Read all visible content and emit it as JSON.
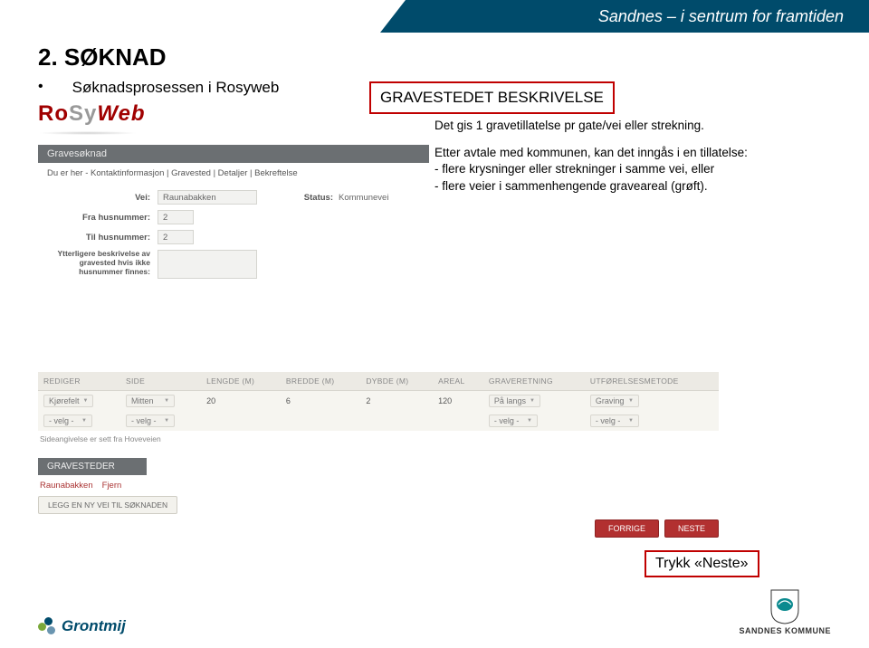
{
  "ribbon": {
    "text": "Sandnes – i sentrum for framtiden"
  },
  "slide": {
    "title": "2. SØKNAD",
    "bullet": "Søknadsprosessen i Rosyweb",
    "box_title": "GRAVESTEDET BESKRIVELSE",
    "side_p1": "Det gis 1 gravetillatelse pr gate/vei eller strekning.",
    "side_p2": "Etter avtale med kommunen, kan det inngås i en tillatelse:",
    "side_li1": "- flere krysninger eller strekninger i samme vei, eller",
    "side_li2": "- flere veier i sammenhengende graveareal (grøft).",
    "neste": "Trykk «Neste»"
  },
  "rosyweb": {
    "p1": "Ro",
    "p2": "Sy",
    "p3": "Web"
  },
  "app": {
    "header": "Gravesøknad",
    "breadcrumb": "Du er her - Kontaktinformasjon | Gravested | Detaljer | Bekreftelse",
    "labels": {
      "vei": "Vei:",
      "fra": "Fra husnummer:",
      "til": "Til husnummer:",
      "ytterligere": "Ytterligere beskrivelse av gravested hvis ikke husnummer finnes:",
      "status": "Status:"
    },
    "values": {
      "vei": "Raunabakken",
      "fra": "2",
      "til": "2",
      "status": "Kommunevei"
    },
    "table": {
      "headers": [
        "REDIGER",
        "SIDE",
        "LENGDE (M)",
        "BREDDE (M)",
        "DYBDE (M)",
        "AREAL",
        "GRAVERETNING",
        "UTFØRELSESMETODE"
      ],
      "row1": [
        "Kjørefelt",
        "Mitten",
        "20",
        "6",
        "2",
        "120",
        "På langs",
        "Graving"
      ],
      "row2_placeholder": "- velg -"
    },
    "sidelabel": "Sideangivelse er sett fra Hoveveien",
    "gs_header": "GRAVESTEDER",
    "gs_item": "Raunabakken",
    "gs_remove": "Fjern",
    "btn_add": "LEGG EN NY VEI TIL SØKNADEN",
    "btn_prev": "FORRIGE",
    "btn_next": "NESTE"
  },
  "footer": {
    "grontmij": "Grontmij",
    "sandnes": "SANDNES KOMMUNE"
  }
}
